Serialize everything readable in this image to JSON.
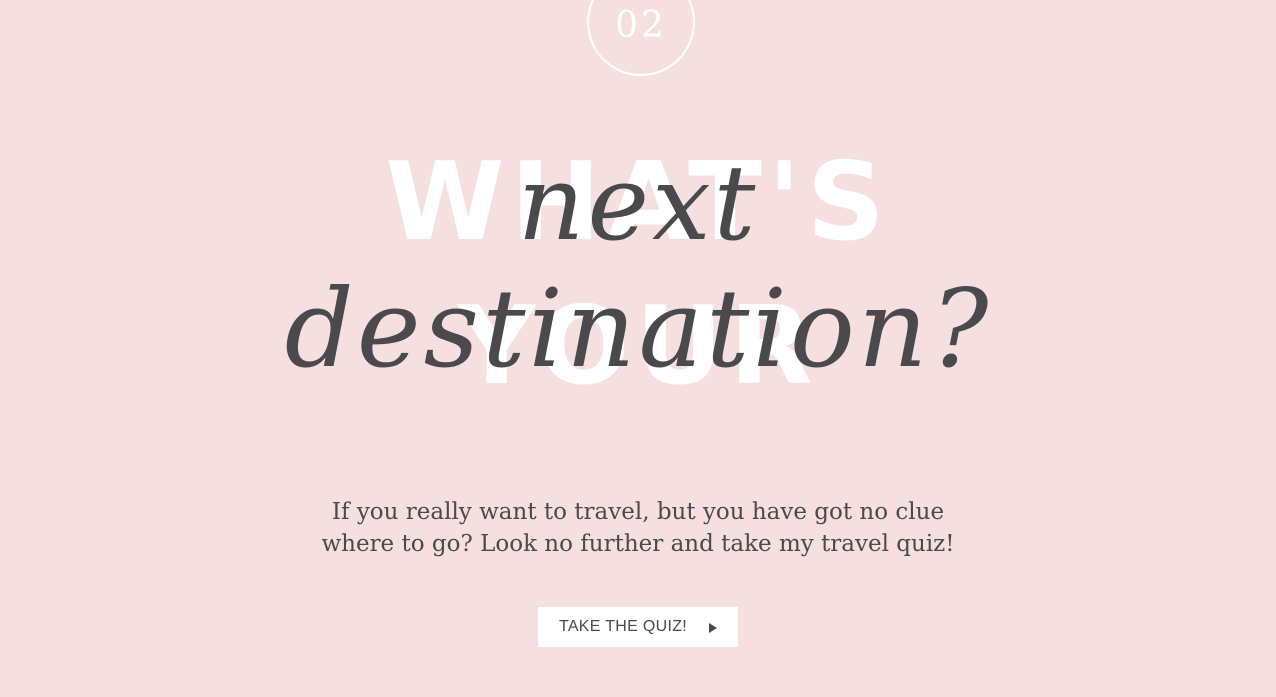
{
  "step": {
    "number": "02"
  },
  "heading": {
    "background_line_1": "WHAT'S",
    "background_line_2": "YOUR",
    "script_line_1": "next",
    "script_line_2": "destination?"
  },
  "intro": {
    "line_1": "If you really want to travel, but you have got no clue",
    "line_2": "where to go? Look no further and take my travel quiz!"
  },
  "cta": {
    "label": "TAKE THE QUIZ!",
    "icon": "play-icon"
  },
  "colors": {
    "background": "#f5dfdf",
    "text": "#4a4a4d",
    "accent": "#ffffff"
  }
}
